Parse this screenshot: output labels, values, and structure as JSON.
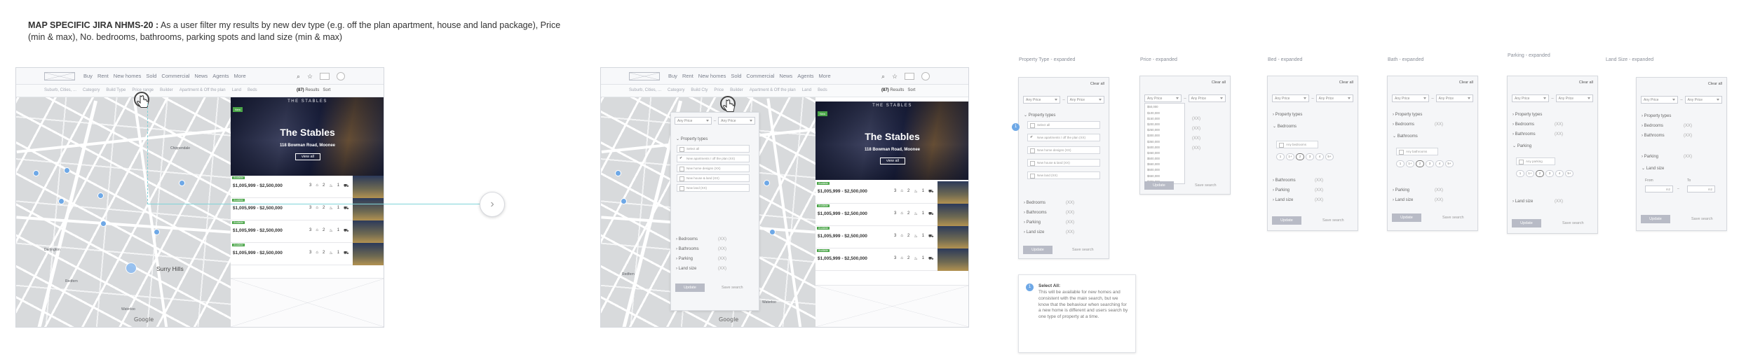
{
  "header": {
    "ticket": "MAP SPECIFIC JIRA NHMS-20 :",
    "story": "As a user filter my results by new dev type (e.g. off the plan apartment, house and land package), Price (min & max), No. bedrooms, bathrooms, parking spots and land size (min & max)"
  },
  "app": {
    "nav": [
      "Buy",
      "Rent",
      "New homes",
      "Sold",
      "Commercial",
      "News",
      "Agents",
      "More"
    ],
    "filters_frame1": [
      "Suburb, Cities, ...",
      "Category",
      "Build Type",
      "Price range",
      "Builder",
      "Apartment & Off the plan",
      "Land",
      "Beds"
    ],
    "filters_frame2": [
      "Suburb, Cities, ...",
      "Category",
      "Build Cty",
      "Price",
      "Builder",
      "Apartment & Off the plan",
      "Land",
      "Beds"
    ],
    "results_count": "(87)",
    "results_suffix": "Results",
    "sort": "Sort",
    "google": "Google",
    "map_labels": [
      "Surry Hills",
      "Redfern",
      "Darlington",
      "Chippendale",
      "Waterloo"
    ],
    "hero": {
      "badge": "New",
      "top": "THE STABLES",
      "title": "The Stables",
      "address": "118 Bowman Road, Moonee",
      "button": "view all"
    },
    "listings": [
      {
        "badge": "Available",
        "price": "$1,005,999 - $2,500,000",
        "beds": "3",
        "baths": "2",
        "cars": "1"
      },
      {
        "badge": "Available",
        "price": "$1,005,999 - $2,500,000",
        "beds": "3",
        "baths": "2",
        "cars": "1"
      },
      {
        "badge": "Available",
        "price": "$1,005,999 - $2,500,000",
        "beds": "3",
        "baths": "2",
        "cars": "1"
      },
      {
        "badge": "Available",
        "price": "$1,005,999 - $2,500,000",
        "beds": "3",
        "baths": "2",
        "cars": "1"
      }
    ]
  },
  "dropdown": {
    "any_price": "Any Price",
    "section": "Property types",
    "select_all": "Select all",
    "options": [
      "New apartments / off the plan (XX)",
      "New home designs (XX)",
      "New house & land (XX)",
      "New land (XX)"
    ],
    "rest": [
      "Bedrooms",
      "Bathrooms",
      "Parking",
      "Land size"
    ],
    "count": "(XX)",
    "update": "Update",
    "save": "Save search"
  },
  "cards": {
    "clear_all": "Clear all",
    "any_price": "Any Price",
    "update": "Update",
    "save": "Save search",
    "labels": [
      "Property Type - expanded",
      "Price - expanded",
      "Bed - expanded",
      "Bath - expanded",
      "Parking - expanded",
      "Land Size - expanded"
    ],
    "property_types": "Property types",
    "bedrooms": "Bedrooms",
    "bathrooms": "Bathrooms",
    "parking": "Parking",
    "land_size": "Land size",
    "count": "(XX)",
    "any_bedrooms": "Any bedrooms",
    "any_bathrooms": "Any bathrooms",
    "any_parking": "Any parking",
    "chips": [
      "1",
      "1+",
      "2",
      "3",
      "4",
      "5+"
    ],
    "price_options": [
      "$50,000",
      "$100,000",
      "$150,000",
      "$200,000",
      "$250,000",
      "$300,000",
      "$350,000",
      "$400,000",
      "$450,000",
      "$500,000",
      "$550,000",
      "$600,000",
      "$650,000",
      "$700,000"
    ],
    "land_from": "From",
    "land_to": "To",
    "land_unit": "m2"
  },
  "note": {
    "number": "1",
    "title": "Select All:",
    "body": "This will be available for new homes and consistent with the main search, but we know that the behaviour when searching for a new home is different and users search by one type of property at a time."
  },
  "colors": {
    "accent": "#6ea8e6",
    "connector": "#7fd3d8",
    "badge_green": "#4aa548",
    "update_btn": "#b8bbc6"
  },
  "icons": {
    "next": "chevron-right-icon",
    "cursor": "hand-pointer-icon",
    "beds": "bed-icon",
    "baths": "bath-icon",
    "cars": "car-icon"
  }
}
